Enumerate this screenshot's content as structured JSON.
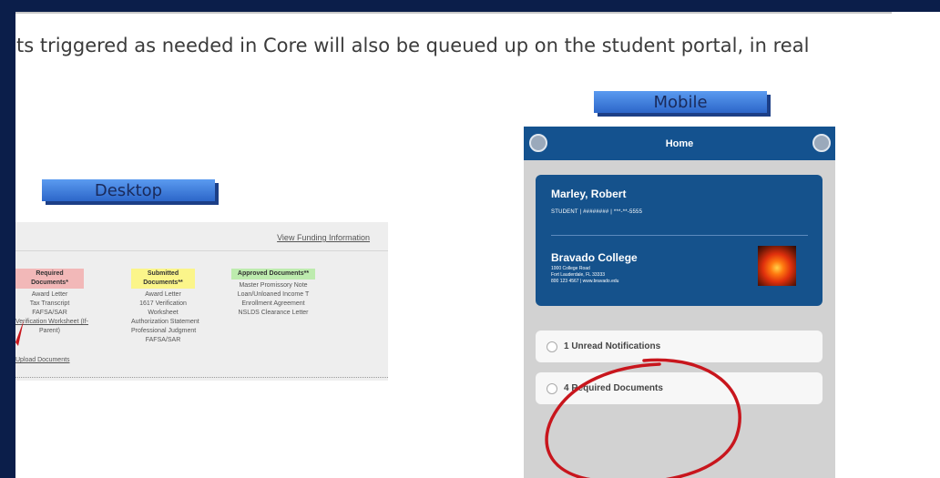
{
  "headline": "ts triggered as needed in Core will also be queued up on the student portal, in real",
  "desktop": {
    "tag_label": "Desktop",
    "link": "View Funding Information",
    "required": {
      "header": "Required Documents*",
      "items": [
        "Award Letter",
        "Tax Transcript",
        "FAFSA/SAR",
        "Verification Worksheet (If-",
        "Parent)"
      ]
    },
    "submitted": {
      "header": "Submitted Documents**",
      "items": [
        "Award Letter",
        "1617 Verification",
        "Worksheet",
        "Authorization Statement",
        "Professional Judgment",
        "FAFSA/SAR"
      ]
    },
    "approved": {
      "header": "Approved Documents**",
      "items": [
        "Master Promissory Note",
        "Loan/Unloaned Income T",
        "Enrollment Agreement",
        "NSLDS Clearance Letter"
      ]
    },
    "upload_label": "Upload Documents"
  },
  "mobile": {
    "tag_label": "Mobile",
    "screen_title": "Home",
    "student_name": "Marley, Robert",
    "student_sub": "STUDENT | ######## | ***-**-5555",
    "college_name": "Bravado College",
    "college_addr_1": "1000 College Road",
    "college_addr_2": "Fort Lauderdale, FL 33333",
    "college_addr_3": "800 123 4567 | www.bravado.edu",
    "notifications_label": "1 Unread Notifications",
    "documents_label": "4 Required Documents"
  },
  "colors": {
    "page_bg": "#0b1e4a",
    "accent_blue": "#14528f",
    "annotation_red": "#c8161d"
  }
}
